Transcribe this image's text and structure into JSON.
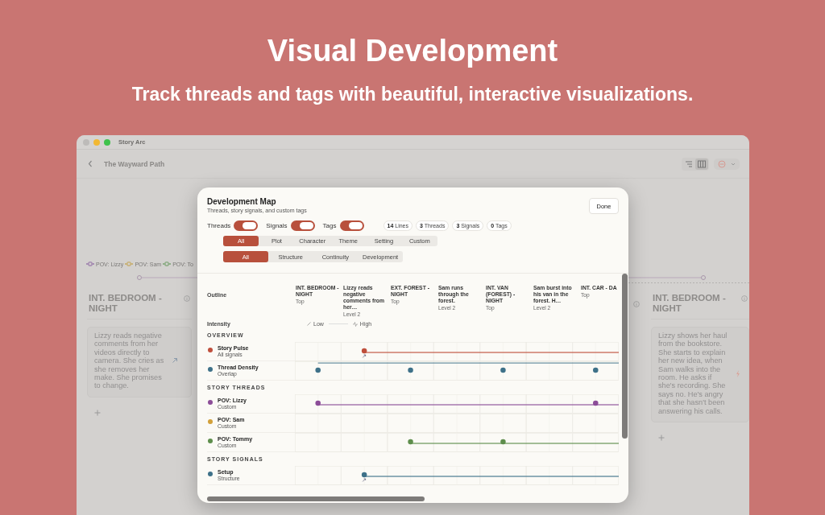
{
  "hero": {
    "title": "Visual Development",
    "subtitle": "Track threads and tags with beautiful, interactive visualizations."
  },
  "window": {
    "title": "Story Arc",
    "document": "The Wayward Path",
    "view_modes": [
      {
        "kind": "list",
        "selected": false
      },
      {
        "kind": "columns",
        "selected": true
      }
    ]
  },
  "board": {
    "legend": [
      {
        "label": "POV: Lizzy",
        "color": "#a68db2"
      },
      {
        "label": "POV: Sam",
        "color": "#c8b27a"
      },
      {
        "label": "POV: To",
        "color": "#8fae88"
      }
    ],
    "scenes": [
      {
        "heading": "INT. BEDROOM - NIGHT",
        "summary": "Lizzy reads negative comments from her videos directly to camera. She cries as she removes her make. She promises to change.",
        "kind": "link"
      },
      {
        "heading": "INT. BEDROOM - NIGHT",
        "summary": "Lizzy shows her haul from the bookstore. She starts to explain her new idea, when Sam walks into the room. He asks if she's recording. She says no. He's angry that she hasn't been answering his calls.",
        "kind": "bolt"
      }
    ]
  },
  "dialog": {
    "title": "Development Map",
    "subtitle": "Threads, story signals, and custom tags",
    "done": "Done",
    "toggles": [
      {
        "label": "Threads",
        "on": true
      },
      {
        "label": "Signals",
        "on": true
      },
      {
        "label": "Tags",
        "on": true
      }
    ],
    "counts": [
      "**14** Lines",
      "**3** Threads",
      "**3** Signals",
      "**0** Tags"
    ],
    "categories": [
      {
        "label": "All",
        "selected": true
      },
      {
        "label": "Plot",
        "selected": false
      },
      {
        "label": "Character",
        "selected": false
      },
      {
        "label": "Theme",
        "selected": false
      },
      {
        "label": "Setting",
        "selected": false
      },
      {
        "label": "Custom",
        "selected": false
      }
    ],
    "signal_filters": [
      {
        "label": "All",
        "selected": true
      },
      {
        "label": "Structure",
        "selected": false
      },
      {
        "label": "Continuity",
        "selected": false
      },
      {
        "label": "Development",
        "selected": false
      }
    ],
    "outline_label": "Outline",
    "intensity_label": "Intensity",
    "intensity_low": "Low",
    "intensity_high": "High",
    "columns": [
      {
        "title": "INT. BEDROOM - NIGHT",
        "tier": "Top"
      },
      {
        "title": "Lizzy reads negative comments from her…",
        "tier": "Level 2"
      },
      {
        "title": "EXT. FOREST - NIGHT",
        "tier": "Top"
      },
      {
        "title": "Sam runs through the forest.",
        "tier": "Level 2"
      },
      {
        "title": "INT. VAN (FOREST) - NIGHT",
        "tier": "Top"
      },
      {
        "title": "Sam burst into his van in the forest. H…",
        "tier": "Level 2"
      },
      {
        "title": "INT. CAR - DA",
        "tier": "Top"
      }
    ],
    "sections": [
      {
        "title": "OVERVIEW",
        "rows": [
          {
            "name": "Story Pulse",
            "type": "All signals",
            "color": "#bf4f3c",
            "kind": "signal",
            "dots": [
              false,
              true,
              false,
              false,
              false,
              false,
              false
            ]
          },
          {
            "name": "Thread Density",
            "type": "Overlap",
            "color": "#3e7189",
            "kind": "density",
            "dots": [
              true,
              false,
              true,
              false,
              true,
              false,
              true
            ]
          }
        ]
      },
      {
        "title": "STORY THREADS",
        "rows": [
          {
            "name": "POV: Lizzy",
            "type": "Custom",
            "color": "#8c4d98",
            "kind": "thread",
            "dots": [
              true,
              false,
              false,
              false,
              false,
              false,
              true
            ]
          },
          {
            "name": "POV: Sam",
            "type": "Custom",
            "color": "#d2a03a",
            "kind": "thread",
            "dots": [
              false,
              false,
              false,
              false,
              false,
              false,
              false
            ]
          },
          {
            "name": "POV: Tommy",
            "type": "Custom",
            "color": "#5e8e4c",
            "kind": "thread",
            "dots": [
              false,
              false,
              true,
              false,
              true,
              false,
              false
            ]
          }
        ]
      },
      {
        "title": "STORY SIGNALS",
        "rows": [
          {
            "name": "Setup",
            "type": "Structure",
            "color": "#3e7189",
            "kind": "signal",
            "dots": [
              false,
              true,
              false,
              false,
              false,
              false,
              false
            ]
          }
        ]
      }
    ]
  }
}
